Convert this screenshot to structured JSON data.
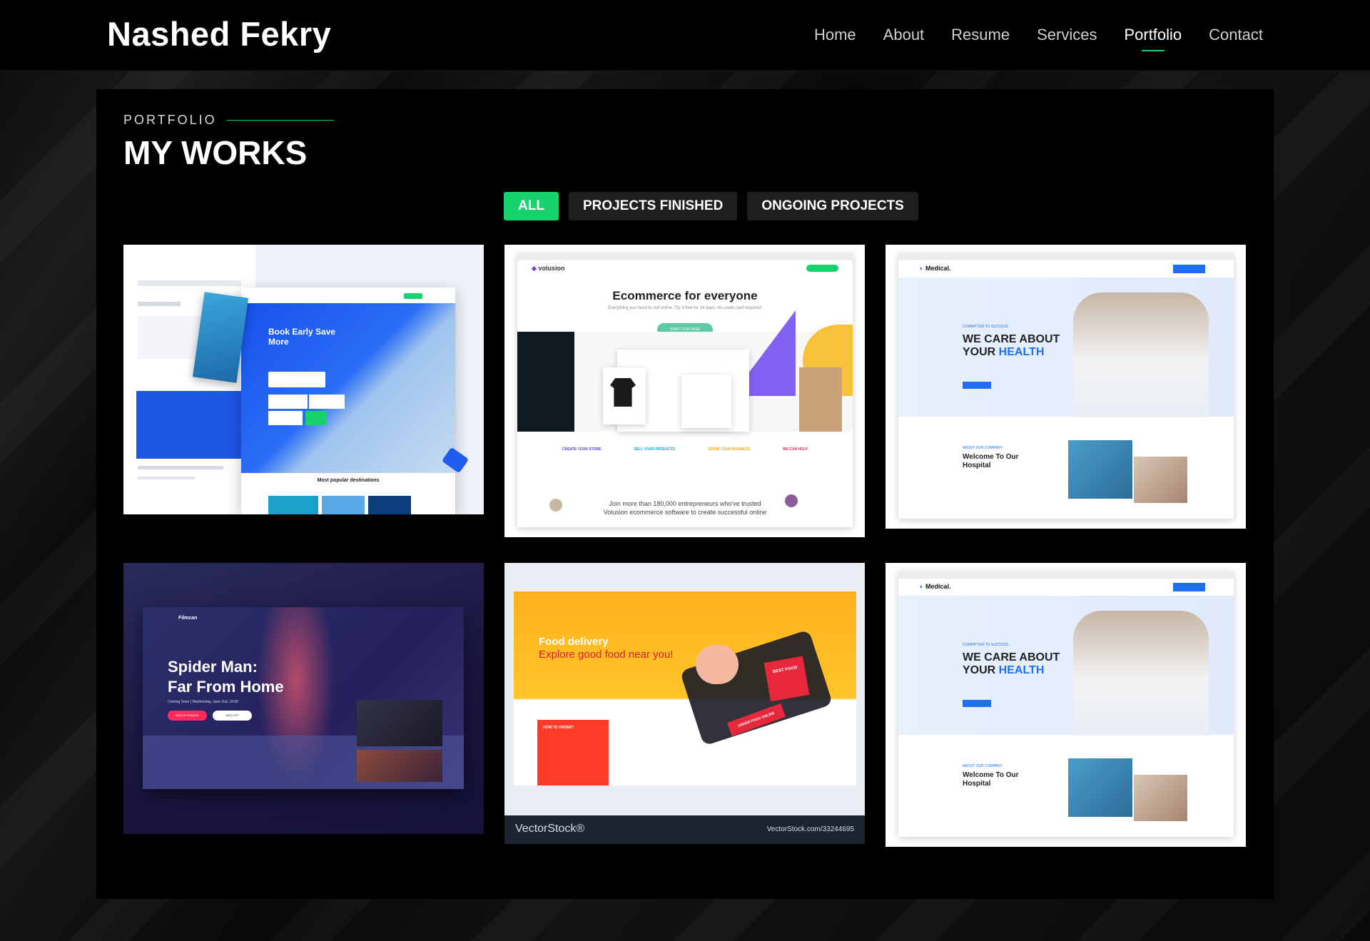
{
  "brand": {
    "name": "Nashed Fekry"
  },
  "nav": {
    "items": [
      "Home",
      "About",
      "Resume",
      "Services",
      "Portfolio",
      "Contact"
    ],
    "active": "Portfolio"
  },
  "section": {
    "label": "PORTFOLIO",
    "title": "MY WORKS"
  },
  "filters": {
    "all": "ALL",
    "finished": "PROJECTS FINISHED",
    "ongoing": "ONGOING PROJECTS"
  },
  "accent_color": "#18d26e",
  "portfolio": {
    "travel": {
      "headline_1": "Book Early Save",
      "headline_2": "More",
      "footer": "Most popular destinations"
    },
    "volusion": {
      "brand": "volusion",
      "headline": "Ecommerce for everyone",
      "sub": "Everything you need to sell online. Try it free for 14 days. No credit card required.",
      "cta": "START FOR FREE",
      "footer_1": "Join more than 180,000 entrepreneurs who've trusted",
      "footer_2": "Volusion ecommerce software to create successful online",
      "f1": "CREATE YOUR STORE",
      "f2": "SELL YOUR PRODUCTS",
      "f3": "GROW YOUR BUSINESS",
      "f4": "WE CAN HELP"
    },
    "medical": {
      "brand": "Medical.",
      "tag": "COMMITTED TO SUCCESS",
      "headline_1": "WE CARE ABOUT",
      "headline_2a": "YOUR ",
      "headline_2b": "HEALTH",
      "about_tag": "ABOUT OUR COMPANY",
      "welcome_1": "Welcome To Our",
      "welcome_2": "Hospital"
    },
    "movie": {
      "brand": "Filmcan",
      "title_1": "Spider Man:",
      "title_2": "Far From Home",
      "coming": "Coming Soon  |  Wednesday, June 2nd, 18:00",
      "watch": "WATCH TRAILER",
      "add": "ADD LIST"
    },
    "food": {
      "headline_1": "Food delivery",
      "headline_2": "Explore good food near you!",
      "how": "HOW TO ORDER?",
      "watermark": "VectorStock®",
      "watermark_id": "VectorStock.com/33244695",
      "badge_1": "BEST FOOD",
      "badge_2": "ORDER FOOD ONLINE"
    }
  }
}
